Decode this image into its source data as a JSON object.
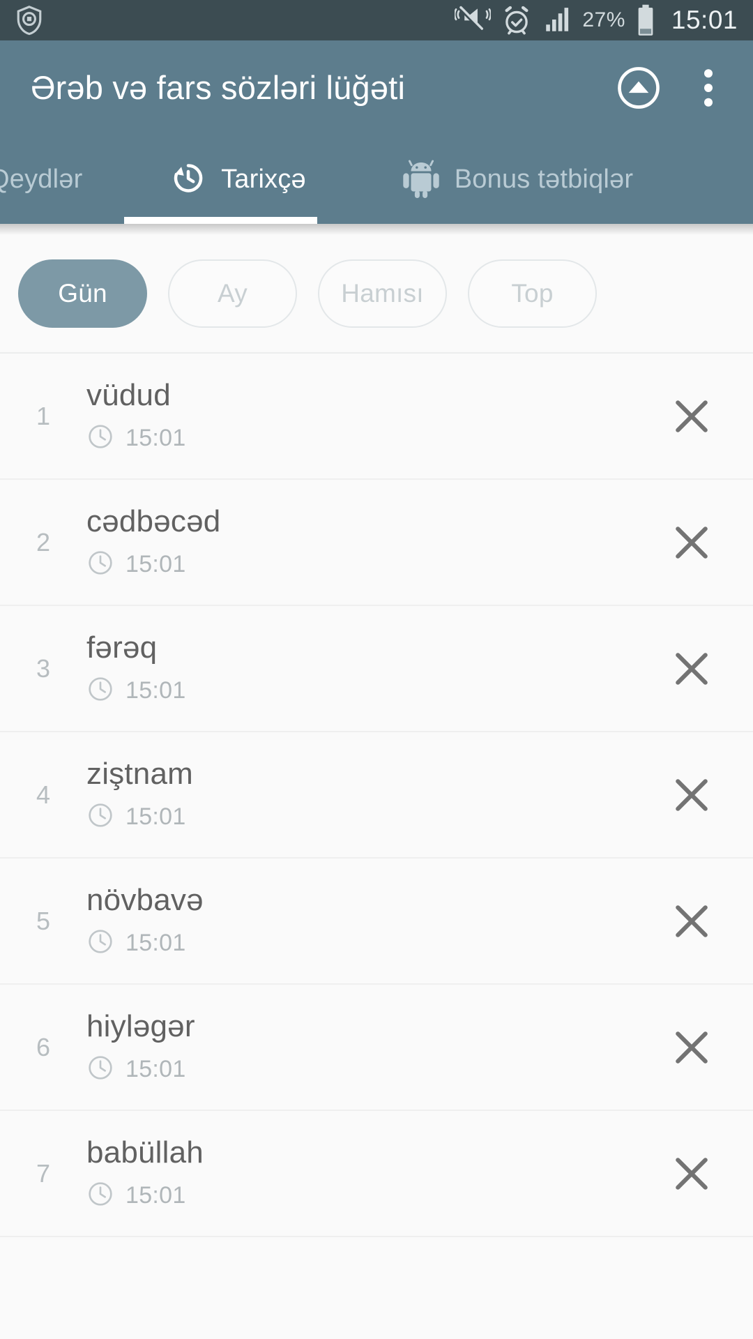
{
  "statusbar": {
    "shield_icon": "shield-security-icon",
    "vibrate_icon": "volume-muted-vibrate-icon",
    "alarm_icon": "alarm-clock-icon",
    "signal_icon": "cellular-signal-icon",
    "battery_percent": "27%",
    "battery_icon": "battery-icon",
    "time": "15:01",
    "bg_color": "#3c4c52",
    "fg_color": "#d2dadd"
  },
  "appbar": {
    "title": "Ərəb və fars sözləri lüğəti",
    "collapse_icon": "circle-arrow-up-icon",
    "overflow_icon": "more-vertical-icon",
    "bg_color": "#5d7d8d"
  },
  "tabs": {
    "active_index": 1,
    "items": [
      {
        "label": "Qeydlər",
        "icon": "bookmark-icon"
      },
      {
        "label": "Tarixçə",
        "icon": "history-icon"
      },
      {
        "label": "Bonus tətbiqlər",
        "icon": "android-robot-icon"
      }
    ],
    "indicator_color": "#ffffff"
  },
  "filters": {
    "active_index": 0,
    "chips": [
      {
        "label": "Gün"
      },
      {
        "label": "Ay"
      },
      {
        "label": "Hamısı"
      },
      {
        "label": "Top"
      }
    ],
    "active_bg": "#7d99a6",
    "idle_border": "#e3e7e9"
  },
  "history": {
    "time_icon": "clock-icon",
    "delete_icon": "close-x-icon",
    "rows": [
      {
        "num": "1",
        "word": "vüdud",
        "time": "15:01"
      },
      {
        "num": "2",
        "word": "cədbəcəd",
        "time": "15:01"
      },
      {
        "num": "3",
        "word": "fərəq",
        "time": "15:01"
      },
      {
        "num": "4",
        "word": "ziştnam",
        "time": "15:01"
      },
      {
        "num": "5",
        "word": "növbavə",
        "time": "15:01"
      },
      {
        "num": "6",
        "word": "hiyləgər",
        "time": "15:01"
      },
      {
        "num": "7",
        "word": "babüllah",
        "time": "15:01"
      }
    ]
  }
}
